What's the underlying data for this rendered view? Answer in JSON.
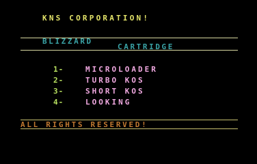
{
  "header": {
    "title": "KNS CORPORATION!",
    "title_color": "#e4e46a"
  },
  "banner": {
    "line1": "BLIZZARD",
    "line2": "CARTRIDGE",
    "color": "#3aa3a6",
    "rule_color": "#d8d8a0"
  },
  "menu": {
    "items": [
      {
        "number": "1-",
        "label": "MICROLOADER"
      },
      {
        "number": "2-",
        "label": "TURBO KOS"
      },
      {
        "number": "3-",
        "label": "SHORT KOS"
      },
      {
        "number": "4-",
        "label": "LOOKING"
      }
    ],
    "number_color": "#b8e060",
    "label_color": "#f0a8e0"
  },
  "footer": {
    "text": "ALL RIGHTS RESERVED!",
    "color": "#c07830",
    "rule_color": "#c8c070"
  }
}
